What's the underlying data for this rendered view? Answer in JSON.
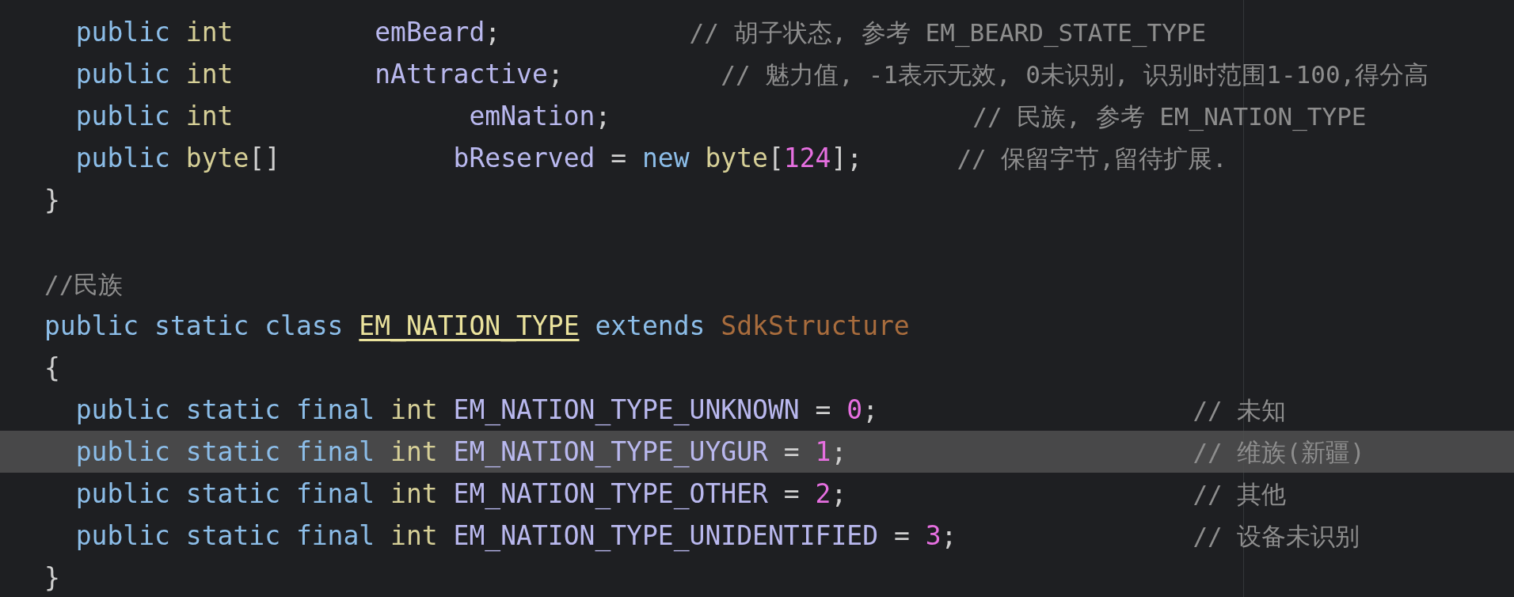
{
  "editor": {
    "lines": [
      {
        "highlighted": false,
        "tokens": [
          {
            "kind": "keyword",
            "text": "  public "
          },
          {
            "kind": "type",
            "text": "int         "
          },
          {
            "kind": "identifier",
            "text": "emBeard"
          },
          {
            "kind": "plain",
            "text": ";            "
          },
          {
            "kind": "comment",
            "text": "// 胡子状态, 参考 EM_BEARD_STATE_TYPE"
          }
        ]
      },
      {
        "highlighted": false,
        "tokens": [
          {
            "kind": "keyword",
            "text": "  public "
          },
          {
            "kind": "type",
            "text": "int         "
          },
          {
            "kind": "identifier",
            "text": "nAttractive"
          },
          {
            "kind": "plain",
            "text": ";          "
          },
          {
            "kind": "comment",
            "text": "// 魅力值, -1表示无效, 0未识别, 识别时范围1-100,得分高"
          }
        ]
      },
      {
        "highlighted": false,
        "tokens": [
          {
            "kind": "keyword",
            "text": "  public "
          },
          {
            "kind": "type",
            "text": "int               "
          },
          {
            "kind": "identifier",
            "text": "emNation"
          },
          {
            "kind": "plain",
            "text": ";                       "
          },
          {
            "kind": "comment",
            "text": "// 民族, 参考 EM_NATION_TYPE"
          }
        ]
      },
      {
        "highlighted": false,
        "tokens": [
          {
            "kind": "keyword",
            "text": "  public "
          },
          {
            "kind": "type",
            "text": "byte"
          },
          {
            "kind": "plain",
            "text": "[]           "
          },
          {
            "kind": "identifier",
            "text": "bReserved"
          },
          {
            "kind": "plain",
            "text": " = "
          },
          {
            "kind": "keyword",
            "text": "new "
          },
          {
            "kind": "type",
            "text": "byte"
          },
          {
            "kind": "plain",
            "text": "["
          },
          {
            "kind": "number",
            "text": "124"
          },
          {
            "kind": "plain",
            "text": "];      "
          },
          {
            "kind": "comment",
            "text": "// 保留字节,留待扩展."
          }
        ]
      },
      {
        "highlighted": false,
        "tokens": [
          {
            "kind": "plain",
            "text": "}"
          }
        ]
      },
      {
        "highlighted": false
      },
      {
        "highlighted": false,
        "tokens": [
          {
            "kind": "comment",
            "text": "//民族"
          }
        ]
      },
      {
        "highlighted": false,
        "tokens": [
          {
            "kind": "keyword",
            "text": "public static class "
          },
          {
            "kind": "class",
            "text": "EM_NATION_TYPE"
          },
          {
            "kind": "keyword",
            "text": " extends "
          },
          {
            "kind": "superclass",
            "text": "SdkStructure"
          }
        ]
      },
      {
        "highlighted": false,
        "tokens": [
          {
            "kind": "plain",
            "text": "{"
          }
        ]
      },
      {
        "highlighted": false,
        "tokens": [
          {
            "kind": "keyword",
            "text": "  public static final "
          },
          {
            "kind": "type",
            "text": "int "
          },
          {
            "kind": "identifier",
            "text": "EM_NATION_TYPE_UNKNOWN"
          },
          {
            "kind": "plain",
            "text": " = "
          },
          {
            "kind": "number",
            "text": "0"
          },
          {
            "kind": "plain",
            "text": ";                    "
          },
          {
            "kind": "comment",
            "text": "// 未知"
          }
        ]
      },
      {
        "highlighted": true,
        "tokens": [
          {
            "kind": "keyword",
            "text": "  public static final "
          },
          {
            "kind": "type",
            "text": "int "
          },
          {
            "kind": "identifier",
            "text": "EM_NATION_TYPE_UYGUR"
          },
          {
            "kind": "plain",
            "text": " = "
          },
          {
            "kind": "number",
            "text": "1"
          },
          {
            "kind": "plain",
            "text": ";                      "
          },
          {
            "kind": "comment",
            "text": "// 维族(新疆)"
          }
        ]
      },
      {
        "highlighted": false,
        "tokens": [
          {
            "kind": "keyword",
            "text": "  public static final "
          },
          {
            "kind": "type",
            "text": "int "
          },
          {
            "kind": "identifier",
            "text": "EM_NATION_TYPE_OTHER"
          },
          {
            "kind": "plain",
            "text": " = "
          },
          {
            "kind": "number",
            "text": "2"
          },
          {
            "kind": "plain",
            "text": ";                      "
          },
          {
            "kind": "comment",
            "text": "// 其他"
          }
        ]
      },
      {
        "highlighted": false,
        "tokens": [
          {
            "kind": "keyword",
            "text": "  public static final "
          },
          {
            "kind": "type",
            "text": "int "
          },
          {
            "kind": "identifier",
            "text": "EM_NATION_TYPE_UNIDENTIFIED"
          },
          {
            "kind": "plain",
            "text": " = "
          },
          {
            "kind": "number",
            "text": "3"
          },
          {
            "kind": "plain",
            "text": ";               "
          },
          {
            "kind": "comment",
            "text": "// 设备未识别"
          }
        ]
      },
      {
        "highlighted": false,
        "tokens": [
          {
            "kind": "plain",
            "text": "}"
          }
        ]
      }
    ]
  }
}
